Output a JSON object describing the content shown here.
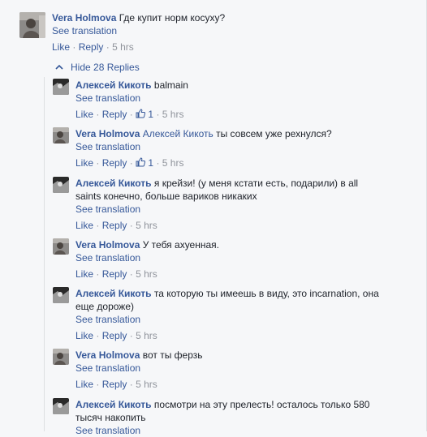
{
  "top_comment": {
    "author": "Vera Holmova",
    "text": "Где купит норм косуху?",
    "see_translation": "See translation",
    "like": "Like",
    "reply": "Reply",
    "time": "5 hrs"
  },
  "hide_replies_label": "Hide 28 Replies",
  "replies": [
    {
      "author": "Алексей Кикоть",
      "text": "balmain",
      "see_translation": "See translation",
      "like": "Like",
      "reply": "Reply",
      "likes": "1",
      "time": "5 hrs"
    },
    {
      "author": "Vera Holmova",
      "mention": "Алексей Кикоть",
      "text": "ты совсем уже рехнулся?",
      "see_translation": "See translation",
      "like": "Like",
      "reply": "Reply",
      "likes": "1",
      "time": "5 hrs"
    },
    {
      "author": "Алексей Кикоть",
      "text": "я крейзи! (у меня кстати есть, подарили) в all",
      "text2": "saints конечно, больше вариков никаких",
      "see_translation": "See translation",
      "like": "Like",
      "reply": "Reply",
      "time": "5 hrs"
    },
    {
      "author": "Vera Holmova",
      "text": "У тебя ахуенная.",
      "see_translation": "See translation",
      "like": "Like",
      "reply": "Reply",
      "time": "5 hrs"
    },
    {
      "author": "Алексей Кикоть",
      "text": "та которую ты имеешь в виду, это incarnation, она",
      "text2": "еще дороже)",
      "see_translation": "See translation",
      "like": "Like",
      "reply": "Reply",
      "time": "5 hrs"
    },
    {
      "author": "Vera Holmova",
      "text": "вот ты ферзь",
      "see_translation": "See translation",
      "like": "Like",
      "reply": "Reply",
      "time": "5 hrs"
    },
    {
      "author": "Алексей Кикоть",
      "text": "посмотри на эту прелесть! осталось только 580",
      "text2": "тысяч накопить",
      "see_translation": "See translation"
    }
  ],
  "separators": {
    "dot": "·"
  },
  "colors": {
    "link": "#365899",
    "meta": "#90949c",
    "text": "#1d2129",
    "background": "#f6f7f9"
  },
  "icons": [
    "avatar-vera",
    "avatar-alexey",
    "chevron-up-icon",
    "thumbs-up-icon"
  ]
}
